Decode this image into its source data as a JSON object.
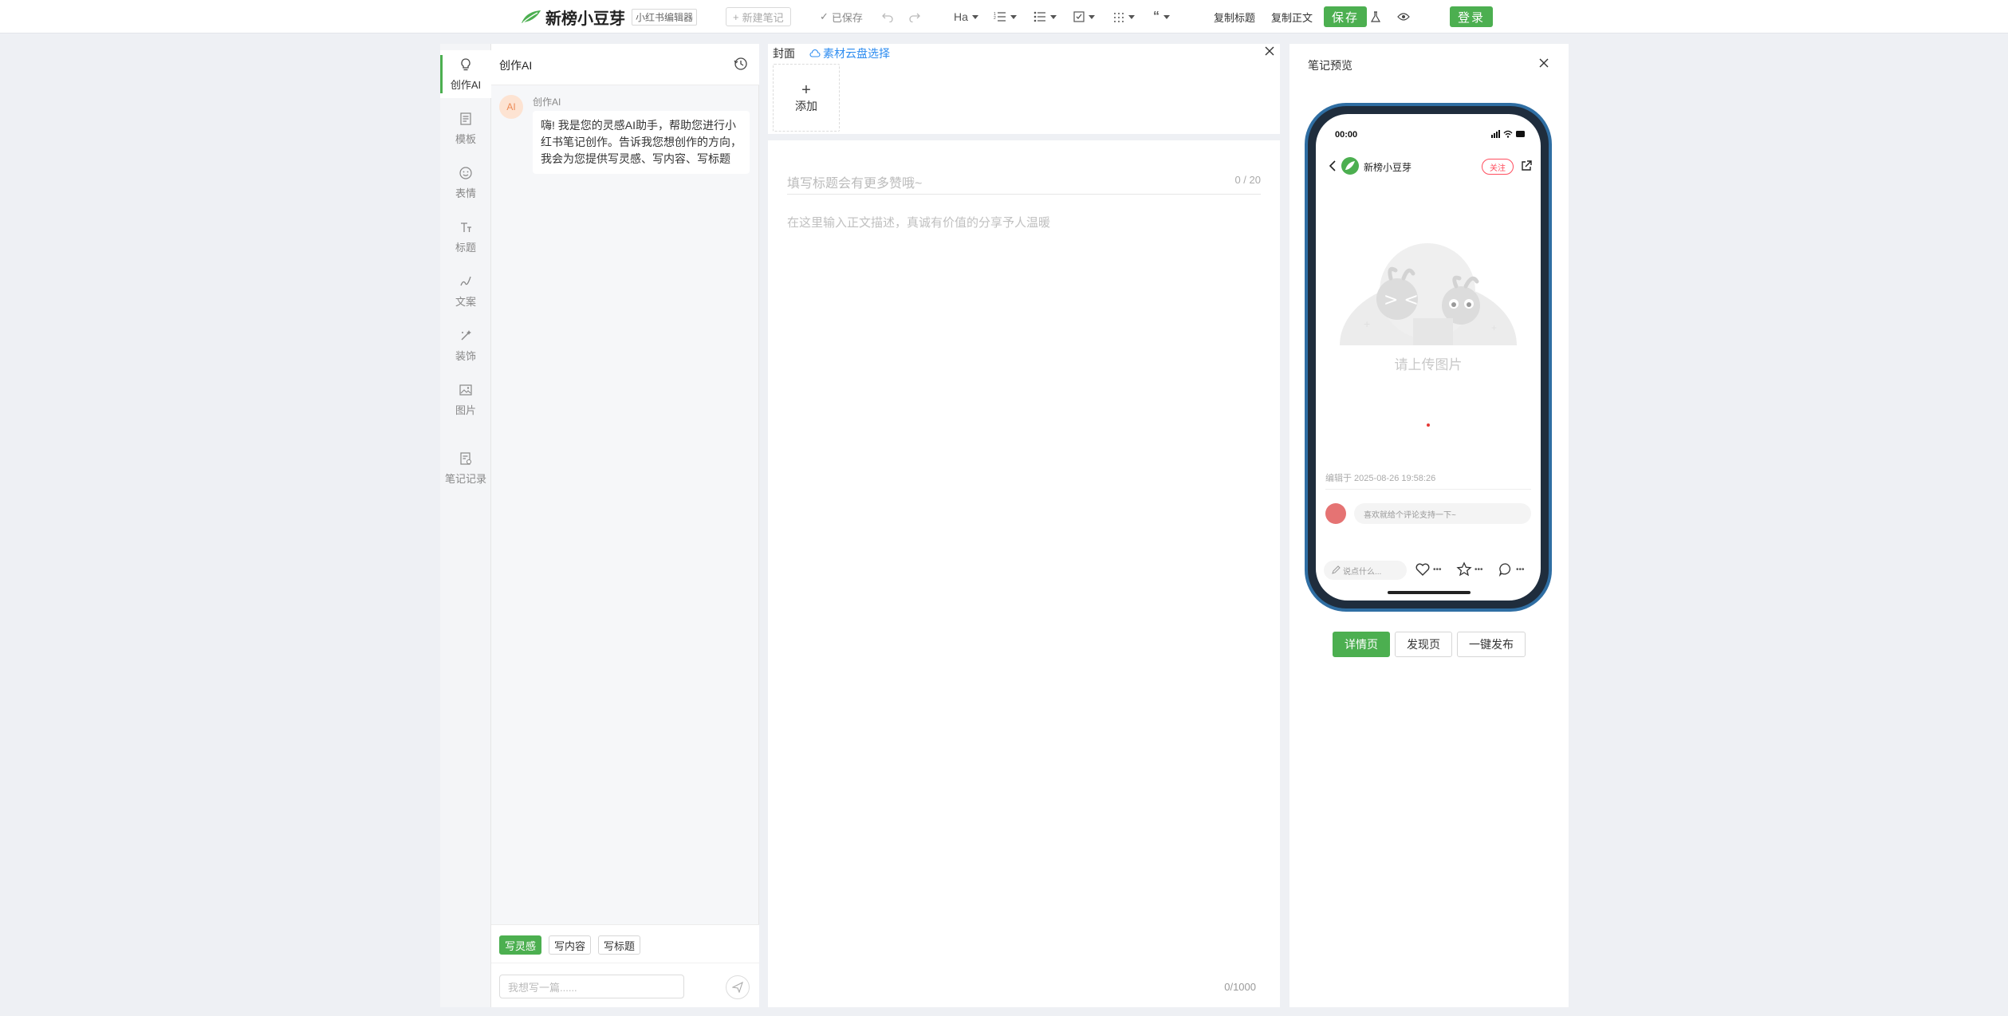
{
  "topbar": {
    "brand": "新榜小豆芽",
    "brand_tag": "小红书编辑器",
    "new_note": "新建笔记",
    "saved": "已保存",
    "heading_tool": "Ha",
    "copy_title": "复制标题",
    "copy_body": "复制正文",
    "save": "保存",
    "login": "登录"
  },
  "leftnav": {
    "items": [
      {
        "label": "创作AI",
        "icon": "lightbulb-icon"
      },
      {
        "label": "模板",
        "icon": "template-icon"
      },
      {
        "label": "表情",
        "icon": "emoji-icon"
      },
      {
        "label": "标题",
        "icon": "title-icon"
      },
      {
        "label": "文案",
        "icon": "copywriting-icon"
      },
      {
        "label": "装饰",
        "icon": "decoration-icon"
      },
      {
        "label": "图片",
        "icon": "image-icon"
      },
      {
        "label": "笔记记录",
        "icon": "note-record-icon"
      }
    ]
  },
  "ai_panel": {
    "title": "创作AI",
    "avatar_text": "AI",
    "assistant_name": "创作AI",
    "greeting": "嗨! 我是您的灵感AI助手，帮助您进行小红书笔记创作。告诉我您想创作的方向，我会为您提供写灵感、写内容、写标题",
    "tabs": [
      "写灵感",
      "写内容",
      "写标题"
    ],
    "input_placeholder": "我想写一篇......"
  },
  "cover": {
    "label": "封面",
    "cloud_link": "素材云盘选择",
    "add_label": "添加"
  },
  "editor": {
    "title_placeholder": "填写标题会有更多赞哦~",
    "title_count": "0 / 20",
    "body_placeholder": "在这里输入正文描述，真诚有价值的分享予人温暖",
    "body_count": "0/1000"
  },
  "preview": {
    "title": "笔记预览",
    "phone": {
      "time": "00:00",
      "account_name": "新榜小豆芽",
      "follow": "关注",
      "upload_hint": "请上传图片",
      "edit_time": "编辑于 2025-08-26 19:58:26",
      "comment_placeholder": "喜欢就给个评论支持一下~",
      "say_placeholder": "说点什么...",
      "like_count": "•••",
      "collect_count": "•••",
      "comment_count": "•••"
    },
    "tabs": [
      "详情页",
      "发现页",
      "一键发布"
    ]
  },
  "colors": {
    "accent": "#4caf50",
    "link": "#2d8cf0",
    "follow": "#ff4d5e",
    "phone_frame": "#2f6ea3"
  }
}
